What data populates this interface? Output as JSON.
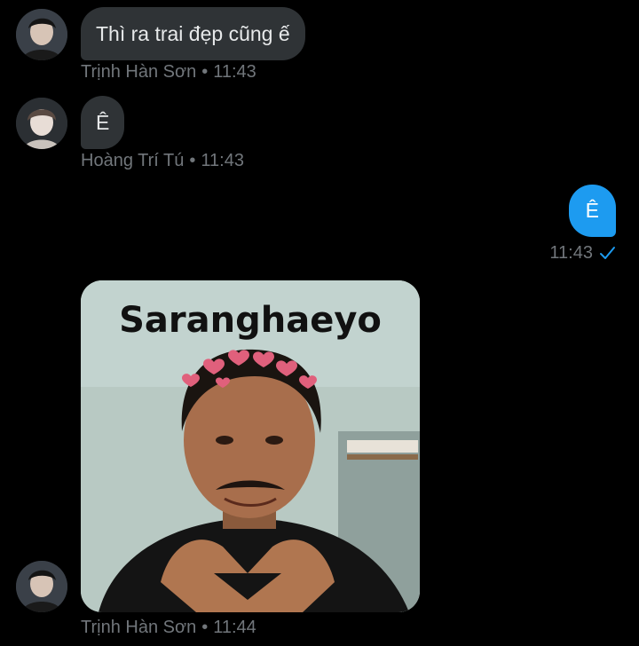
{
  "messages": [
    {
      "sender": "Trịnh Hàn Sơn",
      "text": "Thì ra trai đẹp cũng ế",
      "time": "11:43",
      "avatar": "avatar-trinh-han-son"
    },
    {
      "sender": "Hoàng Trí Tú",
      "text": "Ê",
      "time": "11:43",
      "avatar": "avatar-hoang-tri-tu"
    },
    {
      "sender": "me",
      "text": "Ê",
      "time": "11:43",
      "status_icon": "check-icon"
    },
    {
      "sender": "Trịnh Hàn Sơn",
      "image_caption": "Saranghaeyo",
      "time": "11:44",
      "avatar": "avatar-trinh-han-son"
    }
  ],
  "separator": "•",
  "colors": {
    "background": "#000000",
    "incoming_bubble": "#2f3336",
    "outgoing_bubble": "#1d9bf0",
    "meta_text": "#71767b",
    "check": "#1d9bf0"
  }
}
